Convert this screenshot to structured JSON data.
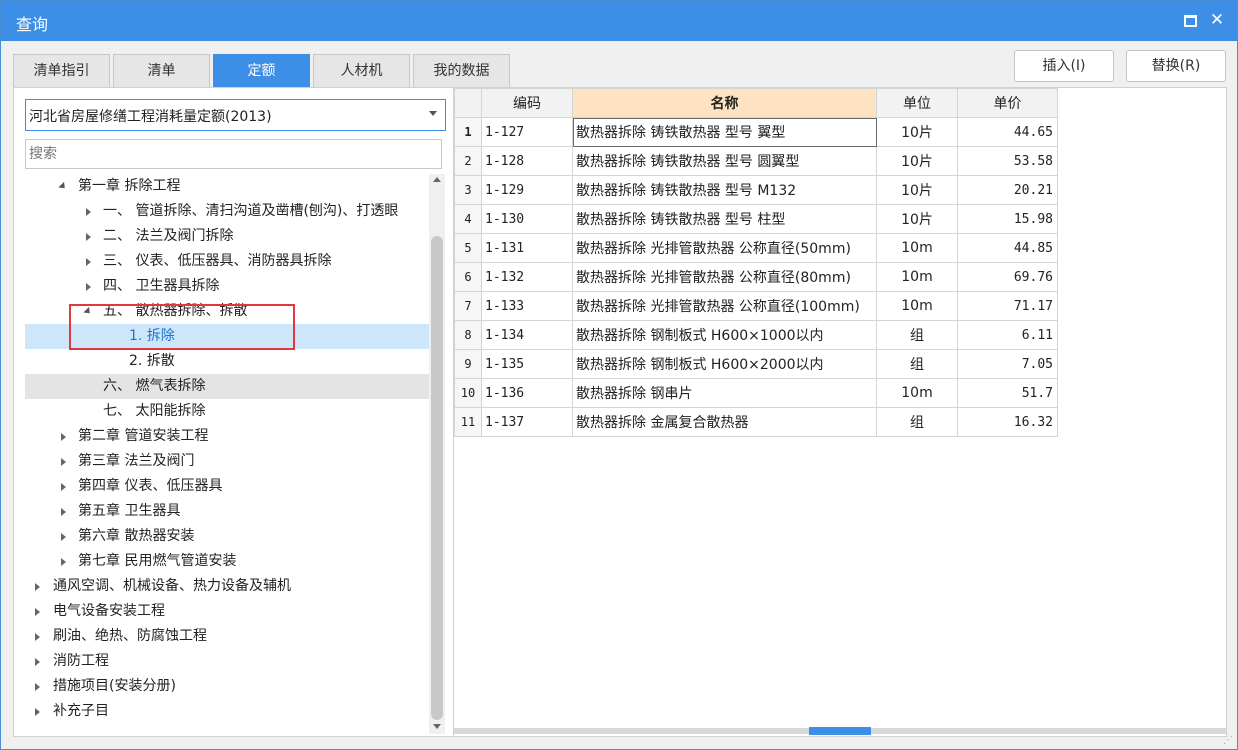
{
  "window": {
    "title": "查询"
  },
  "tabs": [
    {
      "label": "清单指引",
      "active": false
    },
    {
      "label": "清单",
      "active": false
    },
    {
      "label": "定额",
      "active": true
    },
    {
      "label": "人材机",
      "active": false
    },
    {
      "label": "我的数据",
      "active": false
    }
  ],
  "buttons": {
    "insert": "插入(I)",
    "replace": "替换(R)"
  },
  "library_select": {
    "value": "河北省房屋修缮工程消耗量定额(2013)"
  },
  "search": {
    "placeholder": "搜索"
  },
  "tree": [
    {
      "label": "第一章 拆除工程",
      "expanded": true
    },
    {
      "label": "一、  管道拆除、清扫沟道及凿槽(刨沟)、打透眼",
      "expanded": false
    },
    {
      "label": "二、  法兰及阀门拆除",
      "expanded": false
    },
    {
      "label": "三、  仪表、低压器具、消防器具拆除",
      "expanded": false
    },
    {
      "label": "四、  卫生器具拆除",
      "expanded": false
    },
    {
      "label": "五、  散热器拆除、拆散",
      "expanded": true
    },
    {
      "label": "1. 拆除",
      "selected": true
    },
    {
      "label": "2. 拆散"
    },
    {
      "label": "六、  燃气表拆除",
      "hover": true
    },
    {
      "label": "七、  太阳能拆除"
    },
    {
      "label": "第二章 管道安装工程",
      "expanded": false
    },
    {
      "label": "第三章 法兰及阀门",
      "expanded": false
    },
    {
      "label": "第四章 仪表、低压器具",
      "expanded": false
    },
    {
      "label": "第五章 卫生器具",
      "expanded": false
    },
    {
      "label": "第六章 散热器安装",
      "expanded": false
    },
    {
      "label": "第七章 民用燃气管道安装",
      "expanded": false
    },
    {
      "label": "通风空调、机械设备、热力设备及辅机",
      "expanded": false
    },
    {
      "label": "电气设备安装工程",
      "expanded": false
    },
    {
      "label": "刷油、绝热、防腐蚀工程",
      "expanded": false
    },
    {
      "label": "消防工程",
      "expanded": false
    },
    {
      "label": "措施项目(安装分册)",
      "expanded": false
    },
    {
      "label": "补充子目",
      "expanded": false
    }
  ],
  "table": {
    "headers": {
      "code": "编码",
      "name": "名称",
      "unit": "单位",
      "price": "单价"
    },
    "rows": [
      {
        "idx": "1",
        "code": "1-127",
        "name": "散热器拆除 铸铁散热器 型号 翼型",
        "unit": "10片",
        "price": "44.65"
      },
      {
        "idx": "2",
        "code": "1-128",
        "name": "散热器拆除 铸铁散热器 型号 圆翼型",
        "unit": "10片",
        "price": "53.58"
      },
      {
        "idx": "3",
        "code": "1-129",
        "name": "散热器拆除 铸铁散热器 型号 M132",
        "unit": "10片",
        "price": "20.21"
      },
      {
        "idx": "4",
        "code": "1-130",
        "name": "散热器拆除 铸铁散热器 型号 柱型",
        "unit": "10片",
        "price": "15.98"
      },
      {
        "idx": "5",
        "code": "1-131",
        "name": "散热器拆除 光排管散热器 公称直径(50mm)",
        "unit": "10m",
        "price": "44.85"
      },
      {
        "idx": "6",
        "code": "1-132",
        "name": "散热器拆除 光排管散热器 公称直径(80mm)",
        "unit": "10m",
        "price": "69.76"
      },
      {
        "idx": "7",
        "code": "1-133",
        "name": "散热器拆除 光排管散热器 公称直径(100mm)",
        "unit": "10m",
        "price": "71.17"
      },
      {
        "idx": "8",
        "code": "1-134",
        "name": "散热器拆除 钢制板式 H600×1000以内",
        "unit": "组",
        "price": "6.11"
      },
      {
        "idx": "9",
        "code": "1-135",
        "name": "散热器拆除 钢制板式 H600×2000以内",
        "unit": "组",
        "price": "7.05"
      },
      {
        "idx": "10",
        "code": "1-136",
        "name": "散热器拆除 钢串片",
        "unit": "10m",
        "price": "51.7"
      },
      {
        "idx": "11",
        "code": "1-137",
        "name": "散热器拆除 金属复合散热器",
        "unit": "组",
        "price": "16.32"
      }
    ]
  }
}
